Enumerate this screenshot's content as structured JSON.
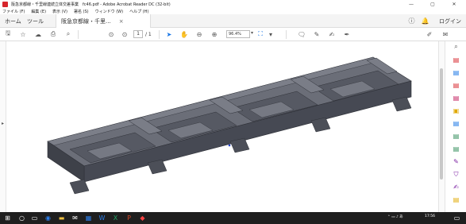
{
  "window": {
    "title": "阪急京都線・千里線連続立体交差事業　fc46.pdf - Adobe Acrobat Reader DC (32-bit)"
  },
  "menu": [
    "ファイル (F)",
    "編集 (E)",
    "表示 (V)",
    "署名 (S)",
    "ウィンドウ (W)",
    "ヘルプ (H)"
  ],
  "tabs": {
    "home": "ホーム",
    "tools": "ツール",
    "document": "阪急京都線・千里...",
    "close": "×",
    "login": "ログイン"
  },
  "toolbar": {
    "page_current": "1",
    "page_total": "/ 1",
    "zoom": "96.4%"
  },
  "colors": {
    "accent": "#1473e6",
    "acrobat_red": "#d7262c",
    "model_face": "#5a5d68",
    "model_dark": "#3f424b",
    "model_light": "#7b7e88"
  },
  "taskbar": {
    "time": "17:56"
  }
}
